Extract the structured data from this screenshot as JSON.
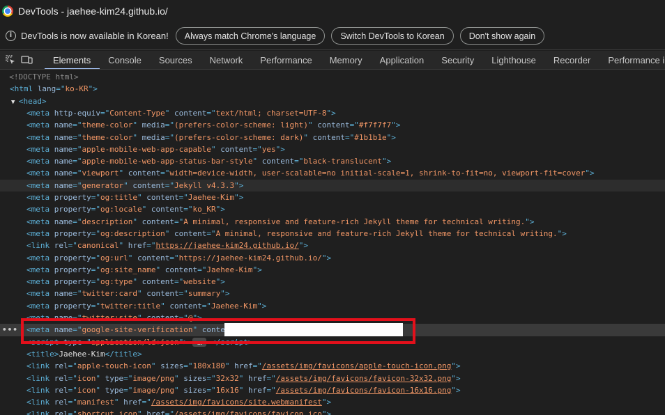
{
  "window": {
    "title": "DevTools - jaehee-kim24.github.io/"
  },
  "infobar": {
    "message": "DevTools is now available in Korean!",
    "btn_match": "Always match Chrome's language",
    "btn_switch": "Switch DevTools to Korean",
    "btn_dismiss": "Don't show again"
  },
  "tabs": [
    "Elements",
    "Console",
    "Sources",
    "Network",
    "Performance",
    "Memory",
    "Application",
    "Security",
    "Lighthouse",
    "Recorder",
    "Performance insights"
  ],
  "active_tab": "Elements",
  "dom": {
    "doctype": "<!DOCTYPE html>",
    "lines": [
      {
        "indent": 1,
        "kind": "open",
        "tag": "html",
        "attrs": [
          [
            "lang",
            "ko-KR"
          ]
        ]
      },
      {
        "indent": 1,
        "kind": "head",
        "tag": "head"
      },
      {
        "indent": 3,
        "kind": "meta",
        "tag": "meta",
        "attrs": [
          [
            "http-equiv",
            "Content-Type"
          ],
          [
            "content",
            "text/html; charset=UTF-8"
          ]
        ]
      },
      {
        "indent": 3,
        "kind": "meta",
        "tag": "meta",
        "attrs": [
          [
            "name",
            "theme-color"
          ],
          [
            "media",
            "(prefers-color-scheme: light)"
          ],
          [
            "content",
            "#f7f7f7"
          ]
        ]
      },
      {
        "indent": 3,
        "kind": "meta",
        "tag": "meta",
        "attrs": [
          [
            "name",
            "theme-color"
          ],
          [
            "media",
            "(prefers-color-scheme: dark)"
          ],
          [
            "content",
            "#1b1b1e"
          ]
        ]
      },
      {
        "indent": 3,
        "kind": "meta",
        "tag": "meta",
        "attrs": [
          [
            "name",
            "apple-mobile-web-app-capable"
          ],
          [
            "content",
            "yes"
          ]
        ]
      },
      {
        "indent": 3,
        "kind": "meta",
        "tag": "meta",
        "attrs": [
          [
            "name",
            "apple-mobile-web-app-status-bar-style"
          ],
          [
            "content",
            "black-translucent"
          ]
        ]
      },
      {
        "indent": 3,
        "kind": "meta",
        "tag": "meta",
        "attrs": [
          [
            "name",
            "viewport"
          ],
          [
            "content",
            "width=device-width, user-scalable=no initial-scale=1, shrink-to-fit=no, viewport-fit=cover"
          ]
        ]
      },
      {
        "indent": 3,
        "kind": "meta",
        "tag": "meta",
        "current": true,
        "attrs": [
          [
            "name",
            "generator"
          ],
          [
            "content",
            "Jekyll v4.3.3"
          ]
        ]
      },
      {
        "indent": 3,
        "kind": "meta",
        "tag": "meta",
        "attrs": [
          [
            "property",
            "og:title"
          ],
          [
            "content",
            "Jaehee-Kim"
          ]
        ]
      },
      {
        "indent": 3,
        "kind": "meta",
        "tag": "meta",
        "attrs": [
          [
            "property",
            "og:locale"
          ],
          [
            "content",
            "ko_KR"
          ]
        ]
      },
      {
        "indent": 3,
        "kind": "meta",
        "tag": "meta",
        "attrs": [
          [
            "name",
            "description"
          ],
          [
            "content",
            "A minimal, responsive and feature-rich Jekyll theme for technical writing."
          ]
        ]
      },
      {
        "indent": 3,
        "kind": "meta",
        "tag": "meta",
        "attrs": [
          [
            "property",
            "og:description"
          ],
          [
            "content",
            "A minimal, responsive and feature-rich Jekyll theme for technical writing."
          ]
        ]
      },
      {
        "indent": 3,
        "kind": "meta",
        "tag": "link",
        "attrs": [
          [
            "rel",
            "canonical"
          ],
          [
            "href",
            "https://jaehee-kim24.github.io/",
            "link"
          ]
        ]
      },
      {
        "indent": 3,
        "kind": "meta",
        "tag": "meta",
        "attrs": [
          [
            "property",
            "og:url"
          ],
          [
            "content",
            "https://jaehee-kim24.github.io/"
          ]
        ]
      },
      {
        "indent": 3,
        "kind": "meta",
        "tag": "meta",
        "attrs": [
          [
            "property",
            "og:site_name"
          ],
          [
            "content",
            "Jaehee-Kim"
          ]
        ]
      },
      {
        "indent": 3,
        "kind": "meta",
        "tag": "meta",
        "attrs": [
          [
            "property",
            "og:type"
          ],
          [
            "content",
            "website"
          ]
        ]
      },
      {
        "indent": 3,
        "kind": "meta",
        "tag": "meta",
        "attrs": [
          [
            "name",
            "twitter:card"
          ],
          [
            "content",
            "summary"
          ]
        ]
      },
      {
        "indent": 3,
        "kind": "meta",
        "tag": "meta",
        "attrs": [
          [
            "property",
            "twitter:title"
          ],
          [
            "content",
            "Jaehee-Kim"
          ]
        ]
      },
      {
        "indent": 3,
        "kind": "meta",
        "tag": "meta",
        "attrs": [
          [
            "name",
            "twitter:site"
          ],
          [
            "content",
            "@"
          ]
        ]
      },
      {
        "indent": 3,
        "kind": "meta",
        "tag": "meta",
        "selected": true,
        "attrs": [
          [
            "name",
            "google-site-verification"
          ],
          [
            "content",
            ""
          ]
        ],
        "suffix": " == $0"
      },
      {
        "indent": 3,
        "kind": "script",
        "tag": "script",
        "attrs": [
          [
            "type",
            "application/ld+json"
          ]
        ],
        "inner": " … "
      },
      {
        "indent": 3,
        "kind": "text",
        "tag": "title",
        "inner": "Jaehee-Kim"
      },
      {
        "indent": 3,
        "kind": "meta",
        "tag": "link",
        "attrs": [
          [
            "rel",
            "apple-touch-icon"
          ],
          [
            "sizes",
            "180x180"
          ],
          [
            "href",
            "/assets/img/favicons/apple-touch-icon.png",
            "link"
          ]
        ]
      },
      {
        "indent": 3,
        "kind": "meta",
        "tag": "link",
        "attrs": [
          [
            "rel",
            "icon"
          ],
          [
            "type",
            "image/png"
          ],
          [
            "sizes",
            "32x32"
          ],
          [
            "href",
            "/assets/img/favicons/favicon-32x32.png",
            "link"
          ]
        ]
      },
      {
        "indent": 3,
        "kind": "meta",
        "tag": "link",
        "attrs": [
          [
            "rel",
            "icon"
          ],
          [
            "type",
            "image/png"
          ],
          [
            "sizes",
            "16x16"
          ],
          [
            "href",
            "/assets/img/favicons/favicon-16x16.png",
            "link"
          ]
        ]
      },
      {
        "indent": 3,
        "kind": "meta",
        "tag": "link",
        "attrs": [
          [
            "rel",
            "manifest"
          ],
          [
            "href",
            "/assets/img/favicons/site.webmanifest",
            "link"
          ]
        ]
      },
      {
        "indent": 3,
        "kind": "meta",
        "tag": "link",
        "attrs": [
          [
            "rel",
            "shortcut icon"
          ],
          [
            "href",
            "/assets/img/favicons/favicon.ico",
            "link"
          ]
        ]
      }
    ]
  },
  "colors": {
    "tag": "#5db0d7",
    "attr": "#9bbbdc",
    "value": "#f29766",
    "highlight_box": "#e3101b"
  }
}
